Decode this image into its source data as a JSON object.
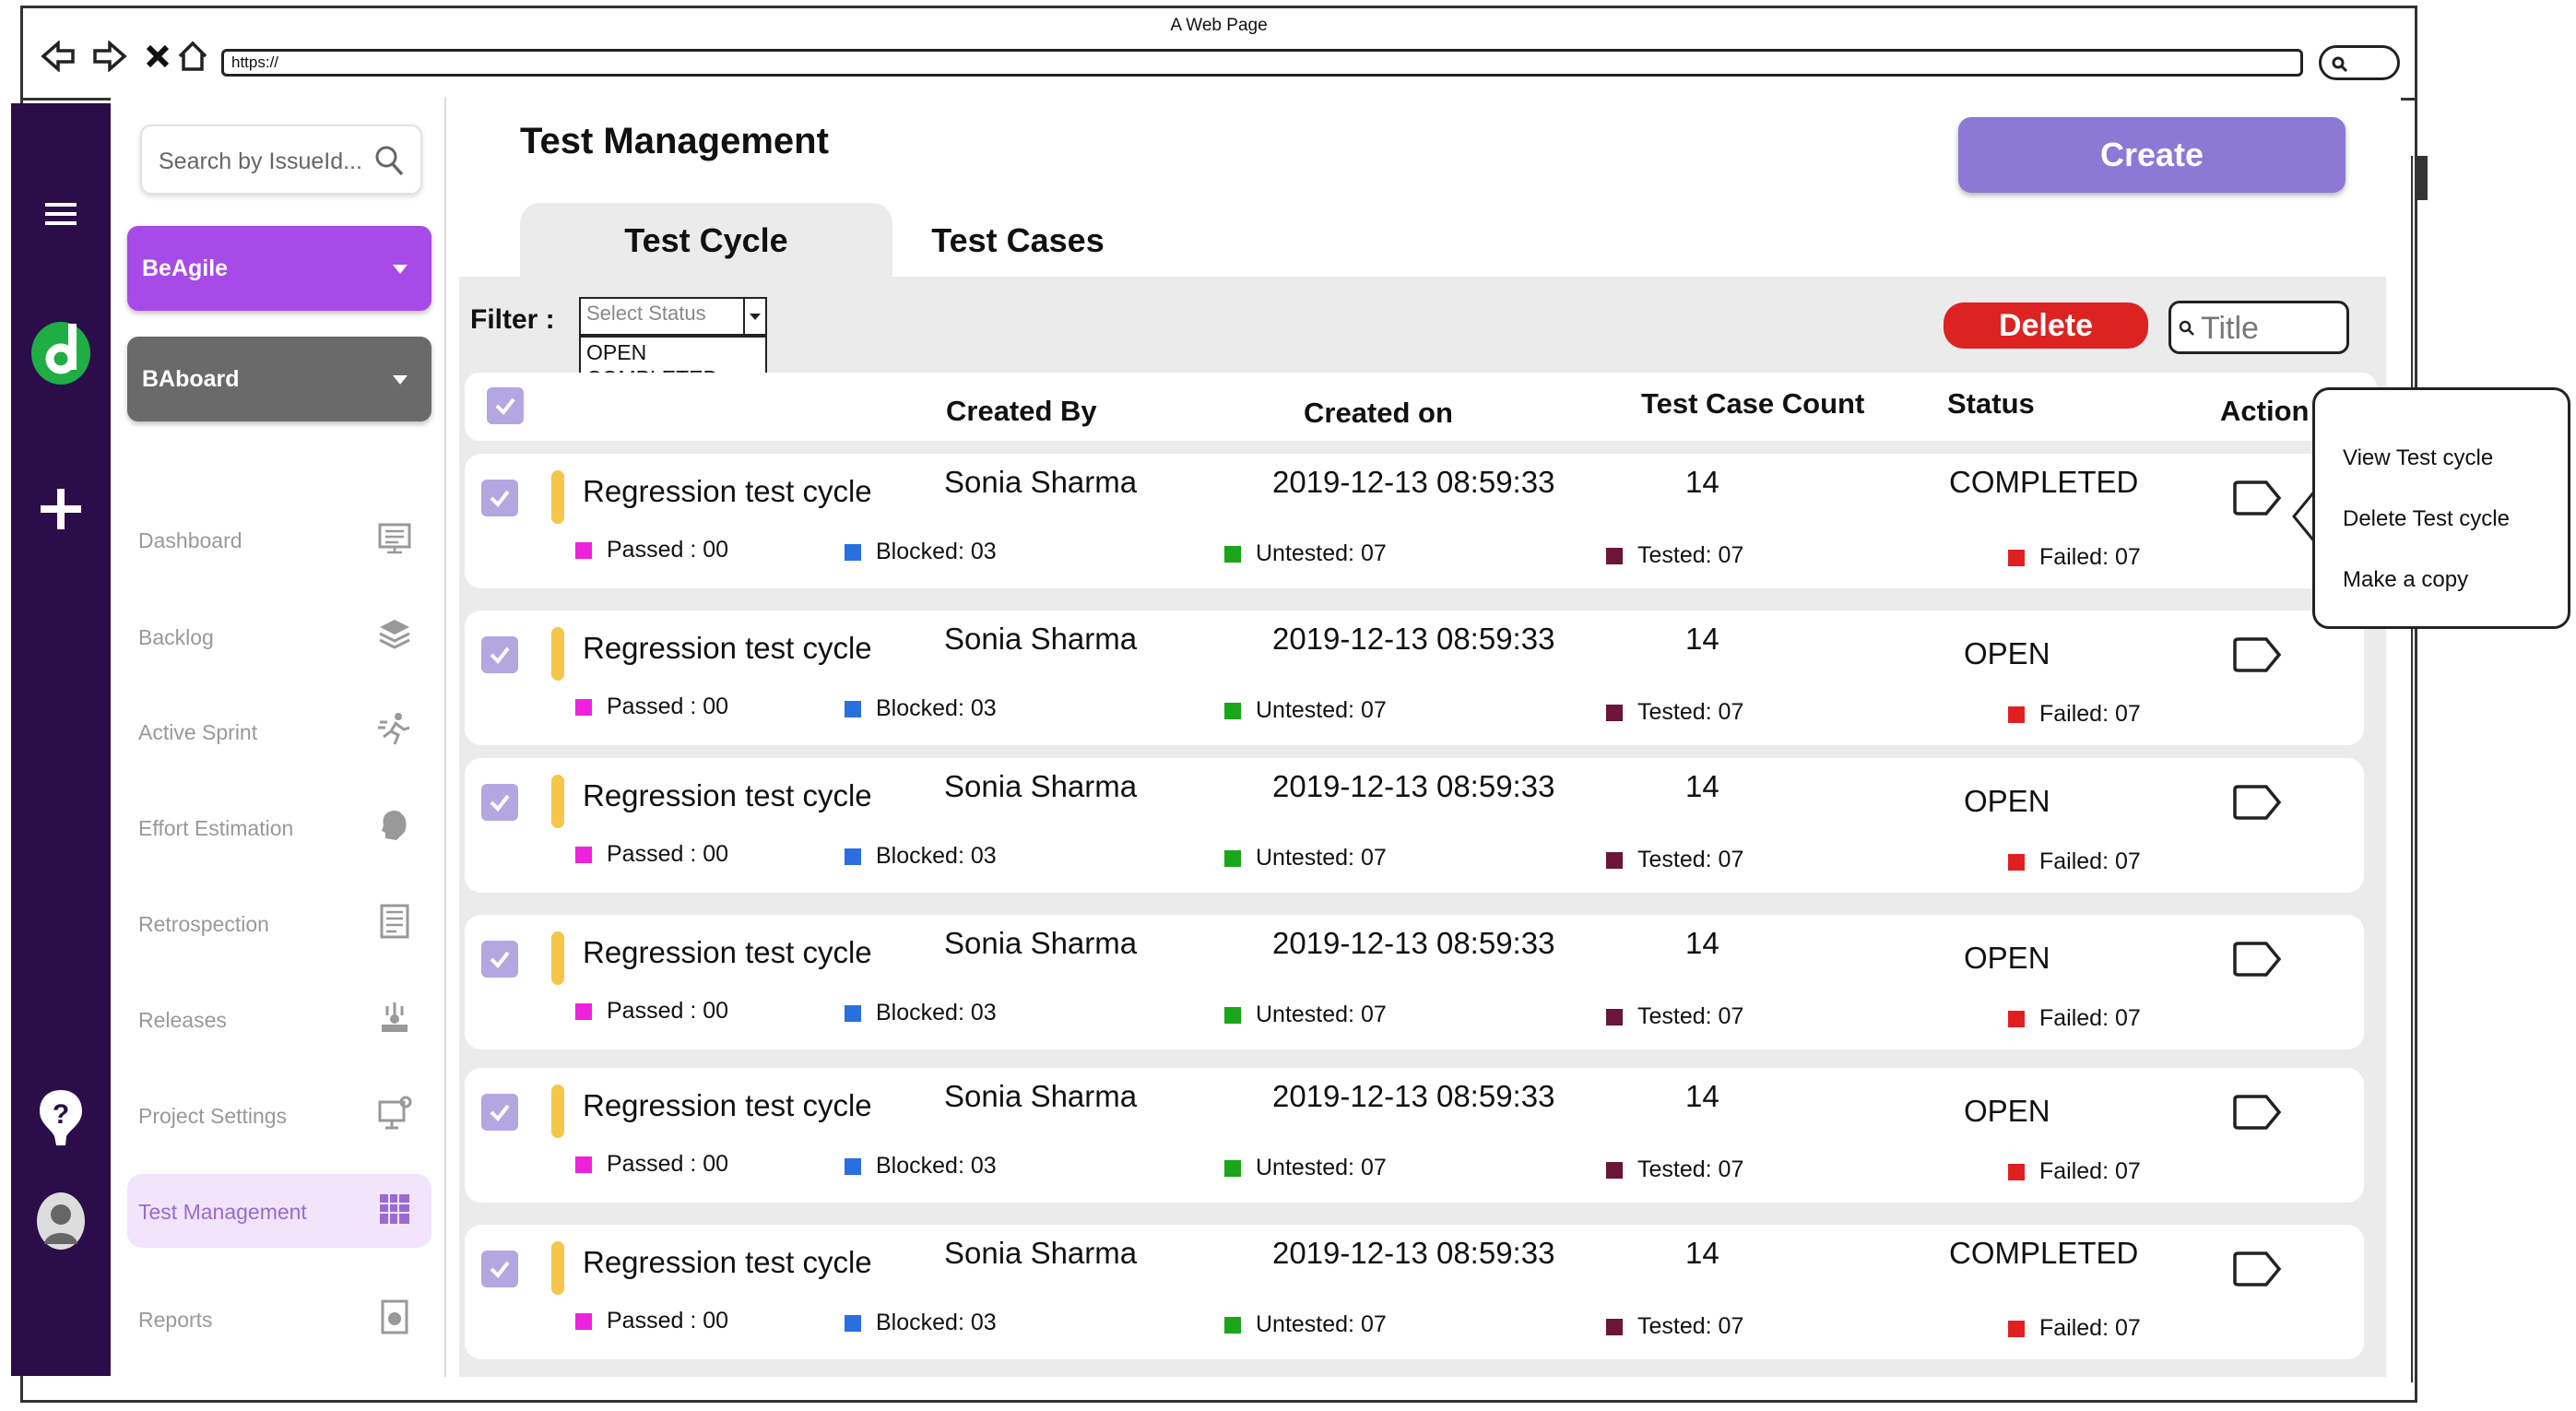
{
  "browser": {
    "window_title": "A Web Page",
    "url": "https://"
  },
  "sidebar": {
    "search_placeholder": "Search by IssueId...",
    "projects": [
      {
        "label": "BeAgile",
        "color": "#a64ae8"
      },
      {
        "label": "BAboard",
        "color": "#6a6a6a"
      }
    ],
    "menu": [
      {
        "label": "Dashboard",
        "icon": "dashboard-icon"
      },
      {
        "label": "Backlog",
        "icon": "layers-icon"
      },
      {
        "label": "Active Sprint",
        "icon": "sprint-runner-icon"
      },
      {
        "label": "Effort Estimation",
        "icon": "head-estimation-icon"
      },
      {
        "label": "Retrospection",
        "icon": "retrospection-board-icon"
      },
      {
        "label": "Releases",
        "icon": "releases-icon"
      },
      {
        "label": "Project Settings",
        "icon": "settings-board-icon"
      },
      {
        "label": "Test Management",
        "icon": "test-management-icon",
        "active": true
      },
      {
        "label": "Reports",
        "icon": "reports-icon"
      }
    ]
  },
  "main": {
    "title": "Test Management",
    "create_label": "Create",
    "tabs": [
      {
        "label": "Test Cycle",
        "active": true
      },
      {
        "label": "Test Cases",
        "active": false
      }
    ],
    "filter": {
      "label": "Filter :",
      "placeholder": "Select Status",
      "options": [
        "OPEN",
        "COMPLETED"
      ]
    },
    "delete_label": "Delete",
    "title_search_placeholder": "Title",
    "columns": {
      "created_by": "Created By",
      "created_on": "Created on",
      "test_case_count": "Test Case Count",
      "status": "Status",
      "action": "Action"
    },
    "rows": [
      {
        "title": "Regression test cycle",
        "created_by": "Sonia Sharma",
        "created_on": "2019-12-13 08:59:33",
        "count": "14",
        "status": "COMPLETED",
        "passed": "Passed : 00",
        "blocked": "Blocked: 03",
        "untested": "Untested: 07",
        "tested": "Tested: 07",
        "failed": "Failed: 07"
      },
      {
        "title": "Regression test cycle",
        "created_by": "Sonia Sharma",
        "created_on": "2019-12-13 08:59:33",
        "count": "14",
        "status": "OPEN",
        "passed": "Passed : 00",
        "blocked": "Blocked: 03",
        "untested": "Untested: 07",
        "tested": "Tested: 07",
        "failed": "Failed: 07"
      },
      {
        "title": "Regression test cycle",
        "created_by": "Sonia Sharma",
        "created_on": "2019-12-13 08:59:33",
        "count": "14",
        "status": "OPEN",
        "passed": "Passed : 00",
        "blocked": "Blocked: 03",
        "untested": "Untested: 07",
        "tested": "Tested: 07",
        "failed": "Failed: 07"
      },
      {
        "title": "Regression test cycle",
        "created_by": "Sonia Sharma",
        "created_on": "2019-12-13 08:59:33",
        "count": "14",
        "status": "OPEN",
        "passed": "Passed : 00",
        "blocked": "Blocked: 03",
        "untested": "Untested: 07",
        "tested": "Tested: 07",
        "failed": "Failed: 07"
      },
      {
        "title": "Regression test cycle",
        "created_by": "Sonia Sharma",
        "created_on": "2019-12-13 08:59:33",
        "count": "14",
        "status": "OPEN",
        "passed": "Passed : 00",
        "blocked": "Blocked: 03",
        "untested": "Untested: 07",
        "tested": "Tested: 07",
        "failed": "Failed: 07"
      },
      {
        "title": "Regression test cycle",
        "created_by": "Sonia Sharma",
        "created_on": "2019-12-13 08:59:33",
        "count": "14",
        "status": "COMPLETED",
        "passed": "Passed : 00",
        "blocked": "Blocked: 03",
        "untested": "Untested: 07",
        "tested": "Tested: 07",
        "failed": "Failed: 07"
      }
    ],
    "stat_colors": {
      "passed": "#ee22dd",
      "blocked": "#2a6fe0",
      "untested": "#1aa51a",
      "tested": "#6b1538",
      "failed": "#e02020"
    }
  },
  "context_menu": {
    "items": [
      "View Test cycle",
      "Delete Test cycle",
      "Make a copy"
    ]
  }
}
